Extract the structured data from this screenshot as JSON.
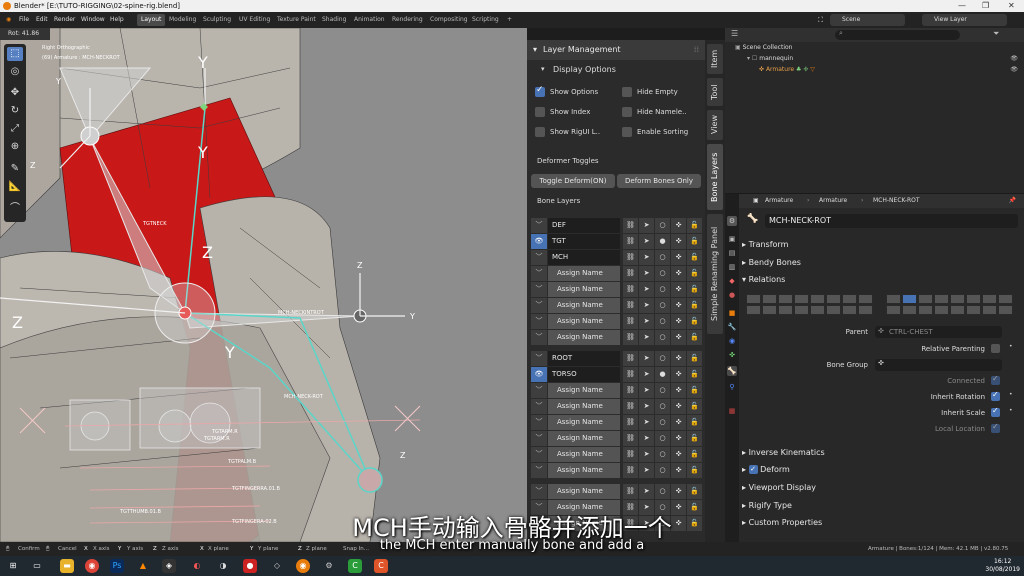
{
  "titlebar": {
    "title": "Blender* [E:\\TUTO-RIGGING\\02-spine-rig.blend]"
  },
  "menubar": {
    "menus": [
      "File",
      "Edit",
      "Render",
      "Window",
      "Help"
    ],
    "workspaces": [
      "Layout",
      "Modeling",
      "Sculpting",
      "UV Editing",
      "Texture Paint",
      "Shading",
      "Animation",
      "Rendering",
      "Compositing",
      "Scripting"
    ],
    "add_tab": "+",
    "scene": "Scene",
    "view_layer": "View Layer"
  },
  "viewport": {
    "rot_info": "Rot: 41.86",
    "view_name": "Right Orthographic",
    "object_info": "(69) Armature : MCH-NECKROT",
    "bone_labels": {
      "tgt_neck": "TGTNECK",
      "mch_neck_int_rot": "MCH-NECKINTROT",
      "mch_neck_rot": "MCH-NECK-ROT",
      "tgt_arm_r": "TGTARM.R",
      "tgt_arm_r2": "TGTARM.R",
      "tgt_palm": "TGTPALM.B",
      "tgt_finger": "TGTFINGERRA.01.B",
      "tgt_finger2": "TGTFINGERA-02.B",
      "tgt_thumb": "TGTTHUMB.01.B"
    },
    "axis_labels": {
      "y": "Y",
      "z": "Z"
    }
  },
  "npanel": {
    "title": "Layer Management",
    "display_options_title": "Display Options",
    "options": [
      {
        "label": "Show Options",
        "checked": true
      },
      {
        "label": "Hide Empty",
        "checked": false
      },
      {
        "label": "Show Index",
        "checked": false
      },
      {
        "label": "Hide Namele..",
        "checked": false
      },
      {
        "label": "Show RigUI L..",
        "checked": false
      },
      {
        "label": "Enable Sorting",
        "checked": false
      }
    ],
    "deformer_toggles": "Deformer Toggles",
    "toggle_deform_btn": "Toggle Deform(ON)",
    "deform_bones_only_btn": "Deform Bones Only",
    "bone_layers_title": "Bone Layers",
    "layers": [
      {
        "name": "DEF",
        "visible": false,
        "named": true
      },
      {
        "name": "TGT",
        "visible": true,
        "named": true
      },
      {
        "name": "MCH",
        "visible": false,
        "named": true
      },
      {
        "name": "Assign Name",
        "visible": false,
        "named": false
      },
      {
        "name": "Assign Name",
        "visible": false,
        "named": false
      },
      {
        "name": "Assign Name",
        "visible": false,
        "named": false
      },
      {
        "name": "Assign Name",
        "visible": false,
        "named": false
      },
      {
        "name": "Assign Name",
        "visible": false,
        "named": false
      },
      {
        "name": "ROOT",
        "visible": false,
        "named": true
      },
      {
        "name": "TORSO",
        "visible": true,
        "named": true
      },
      {
        "name": "Assign Name",
        "visible": false,
        "named": false
      },
      {
        "name": "Assign Name",
        "visible": false,
        "named": false
      },
      {
        "name": "Assign Name",
        "visible": false,
        "named": false
      },
      {
        "name": "Assign Name",
        "visible": false,
        "named": false
      },
      {
        "name": "Assign Name",
        "visible": false,
        "named": false
      },
      {
        "name": "Assign Name",
        "visible": false,
        "named": false
      },
      {
        "name": "Assign Name",
        "visible": false,
        "named": false
      },
      {
        "name": "Assign Name",
        "visible": false,
        "named": false
      },
      {
        "name": "Assign Name",
        "visible": false,
        "named": false
      }
    ]
  },
  "vtabs": [
    "Item",
    "Tool",
    "View",
    "Bone Layers",
    "Simple Renaming Panel"
  ],
  "outliner": {
    "search_placeholder": "",
    "rows": [
      "Scene Collection",
      "mannequin",
      "Armature"
    ]
  },
  "properties": {
    "breadcrumb": [
      "Armature",
      "Armature",
      "MCH-NECK-ROT"
    ],
    "bone_name": "MCH-NECK-ROT",
    "sections": [
      "Transform",
      "Bendy Bones",
      "Relations"
    ],
    "parent_label": "Parent",
    "parent_value": "CTRL-CHEST",
    "relative_parenting": "Relative Parenting",
    "bone_group_label": "Bone Group",
    "connected": "Connected",
    "inherit_rotation": "Inherit Rotation",
    "inherit_scale": "Inherit Scale",
    "local_location": "Local Location",
    "lower_sections": [
      "Inverse Kinematics",
      "Deform",
      "Viewport Display",
      "Rigify Type",
      "Custom Properties"
    ]
  },
  "statusbar": {
    "items": [
      "Confirm",
      "Cancel",
      "X axis",
      "Y axis",
      "Z axis",
      "X plane",
      "Y plane",
      "Z plane",
      "Snap In..."
    ],
    "keys": [
      "X",
      "Y",
      "Z",
      "X",
      "Y",
      "Z"
    ],
    "stats": "Armature | Bones:1/124 | Mem: 42.1 MB | v2.80.75"
  },
  "subtitles": {
    "chinese": "MCH手动输入骨骼并添加一个",
    "english": "the MCH enter manually bone and add a"
  },
  "taskbar": {
    "time": "16:12",
    "date": "30/08/2019"
  },
  "colors": {
    "accent": "#4772b3",
    "brand": "#e87d0d",
    "mesh_red": "#c81818",
    "bone_cyan": "#5ad6c8"
  }
}
